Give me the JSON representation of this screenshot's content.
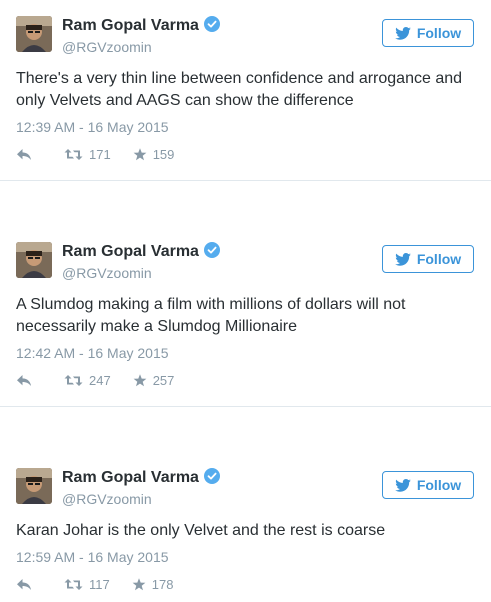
{
  "colors": {
    "accent": "#3b94d9",
    "muted": "#8899a6",
    "text": "#292f33",
    "border": "#e1e8ed"
  },
  "tweets": [
    {
      "name": "Ram Gopal Varma",
      "handle": "@RGVzoomin",
      "follow_label": "Follow",
      "text": "There's a very thin line between confidence and arrogance and only Velvets and AAGS can show the difference",
      "time": "12:39 AM - 16 May 2015",
      "retweets": "171",
      "likes": "159"
    },
    {
      "name": "Ram Gopal Varma",
      "handle": "@RGVzoomin",
      "follow_label": "Follow",
      "text": "A Slumdog making a film with millions of dollars will not necessarily make a Slumdog Millionaire",
      "time": "12:42 AM - 16 May 2015",
      "retweets": "247",
      "likes": "257"
    },
    {
      "name": "Ram Gopal Varma",
      "handle": "@RGVzoomin",
      "follow_label": "Follow",
      "text": "Karan Johar is the only Velvet and the rest is coarse",
      "time": "12:59 AM - 16 May 2015",
      "retweets": "117",
      "likes": "178"
    }
  ]
}
